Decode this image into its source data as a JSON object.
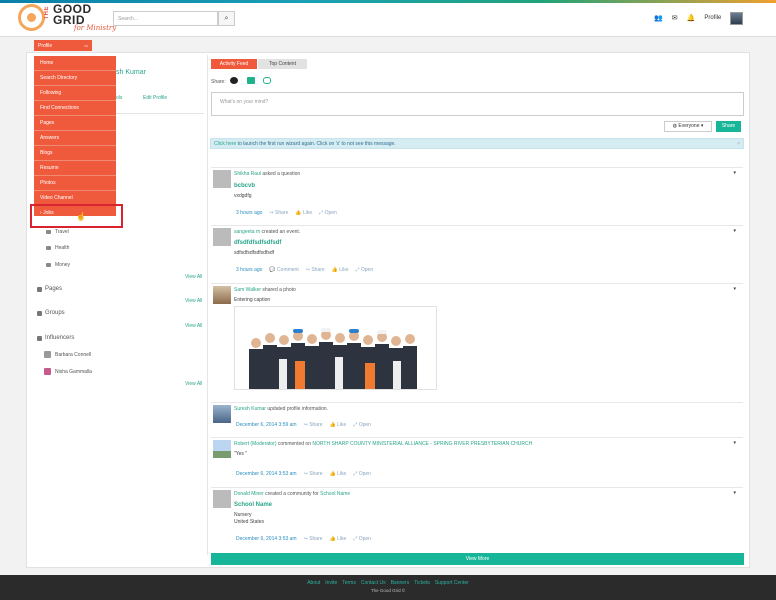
{
  "header": {
    "logo_prefix": "THE",
    "logo_main": "GOOD\nGRID",
    "logo_tagline": "for Ministry",
    "search_placeholder": "Search...",
    "profile_label": "Profile"
  },
  "nav": {
    "profile_tab": "Profile",
    "menu_items": [
      "Home",
      "Search Directory",
      "Following",
      "Find Connections",
      "Pages",
      "Answers",
      "Blogs",
      "Resume",
      "Photos",
      "Video Channel",
      "Jobs"
    ]
  },
  "left": {
    "name_fragment": "sh Kumar",
    "link_fragment": "ols",
    "edit_profile": "Edit Profile",
    "interests": [
      "Travel",
      "Health",
      "Money"
    ],
    "view_all": "View All",
    "pages_head": "Pages",
    "groups_head": "Groups",
    "influencers_head": "Influencers",
    "influencers": [
      "Barbara Connell",
      "Nisha Gammalla"
    ]
  },
  "feed": {
    "tab_activity": "Activity Feed",
    "tab_top": "Top Content",
    "share_label": "Share:",
    "status_placeholder": "What's on your mind?",
    "audience": "Everyone",
    "share_button": "Share",
    "wizard_link": "Click here",
    "wizard_text": " to launch the first run wizard again. Click on 'x' to not see this message.",
    "wizard_close": "×",
    "view_more": "View More",
    "posts": [
      {
        "name": "Shikha Raul",
        "action": " asked a question",
        "title": "bcbcvb",
        "body": "vxdgdfg",
        "time": "3 hours ago",
        "actions": [
          "Share",
          "Like",
          "Open"
        ]
      },
      {
        "name": "sangeeta m",
        "action": " created an event.",
        "title": "dfsdfdfsdfsdfsdf",
        "body": "sdfsdfsdfsdfsdfsdf",
        "time": "3 hours ago",
        "actions": [
          "Comment",
          "Share",
          "Like",
          "Open"
        ]
      },
      {
        "name": "Sam Walker",
        "action": " shared a photo",
        "body": "Entering caption"
      },
      {
        "name": "Suresh Kumar",
        "action": " updated profile information.",
        "time": "December 6, 2014 3:59 am",
        "actions": [
          "Share",
          "Like",
          "Open"
        ]
      },
      {
        "name": "Robert (Moderator)",
        "action": " commented on ",
        "target": "NORTH SHARP COUNTY MINISTERIAL ALLIANCE - SPRING RIVER PRESBYTERIAN CHURCH",
        "body": "\"Yes \"",
        "time": "December 6, 2014 3:53 am",
        "actions": [
          "Share",
          "Like",
          "Open"
        ]
      },
      {
        "name": "Donald Miner",
        "action": " created a community for ",
        "target": "School Name",
        "title": "School Name",
        "body_lines": [
          "Nursery",
          "United States"
        ],
        "time": "December 6, 2014 3:53 am",
        "actions": [
          "Share",
          "Like",
          "Open"
        ]
      }
    ]
  },
  "footer": {
    "links": [
      "About",
      "Invite",
      "Terms",
      "Contact Us",
      "Banners",
      "Tickets",
      "Support Center"
    ],
    "copyright": "The Good Grid ©"
  },
  "colors": {
    "accent": "#f05a3c",
    "teal": "#18b698",
    "link": "#2aa58a",
    "highlight_box": "#d9242f"
  }
}
